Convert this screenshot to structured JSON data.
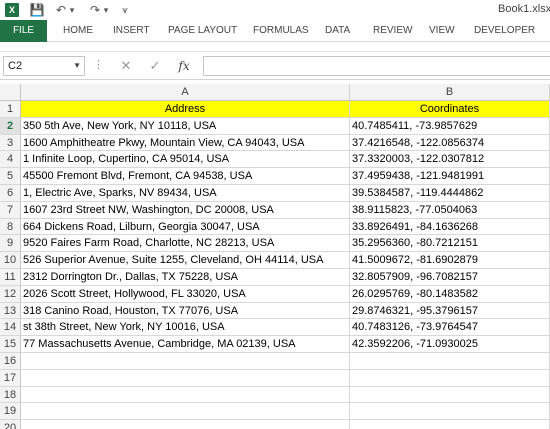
{
  "app": {
    "logo_letter": "X",
    "window_title": "Book1.xlsx -"
  },
  "quick_access": [
    {
      "name": "save-icon",
      "glyph": "💾"
    },
    {
      "name": "undo-icon",
      "glyph": "↶"
    },
    {
      "name": "undo-dropdown-icon",
      "glyph": "▾"
    },
    {
      "name": "redo-icon",
      "glyph": "↷"
    },
    {
      "name": "redo-dropdown-icon",
      "glyph": "▾"
    },
    {
      "name": "customize-toolbar-icon",
      "glyph": "⩛"
    }
  ],
  "ribbon": {
    "tabs": [
      "FILE",
      "HOME",
      "INSERT",
      "PAGE LAYOUT",
      "FORMULAS",
      "DATA",
      "REVIEW",
      "VIEW",
      "DEVELOPER"
    ]
  },
  "formula_bar": {
    "name_box": "C2",
    "separator": "⋮",
    "cancel_glyph": "✕",
    "enter_glyph": "✓",
    "fx_label": "fx",
    "formula": ""
  },
  "grid": {
    "columns": [
      "A",
      "B"
    ],
    "active_cell": "C2",
    "rows": [
      {
        "num": "1",
        "a": "Address",
        "b": "Coordinates"
      },
      {
        "num": "2",
        "a": "350 5th Ave, New York, NY 10118, USA",
        "b": "40.7485411, -73.9857629"
      },
      {
        "num": "3",
        "a": "1600 Amphitheatre Pkwy, Mountain View, CA 94043, USA",
        "b": "37.4216548, -122.0856374"
      },
      {
        "num": "4",
        "a": "1 Infinite Loop, Cupertino, CA 95014, USA",
        "b": "37.3320003, -122.0307812"
      },
      {
        "num": "5",
        "a": "45500 Fremont Blvd, Fremont, CA 94538, USA",
        "b": "37.4959438, -121.9481991"
      },
      {
        "num": "6",
        "a": "1, Electric Ave, Sparks, NV 89434, USA",
        "b": "39.5384587, -119.4444862"
      },
      {
        "num": "7",
        "a": "1607 23rd Street NW, Washington, DC 20008, USA",
        "b": "38.9115823, -77.0504063"
      },
      {
        "num": "8",
        "a": "664 Dickens Road, Lilburn, Georgia 30047, USA",
        "b": "33.8926491, -84.1636268"
      },
      {
        "num": "9",
        "a": "9520 Faires Farm Road, Charlotte, NC 28213, USA",
        "b": "35.2956360, -80.7212151"
      },
      {
        "num": "10",
        "a": "526 Superior Avenue, Suite 1255, Cleveland, OH 44114, USA",
        "b": "41.5009672, -81.6902879"
      },
      {
        "num": "11",
        "a": "2312 Dorrington Dr., Dallas, TX 75228, USA",
        "b": "32.8057909, -96.7082157"
      },
      {
        "num": "12",
        "a": "2026 Scott Street, Hollywood, FL 33020, USA",
        "b": "26.0295769, -80.1483582"
      },
      {
        "num": "13",
        "a": "318 Canino Road, Houston, TX 77076, USA",
        "b": "29.8746321, -95.3796157"
      },
      {
        "num": "14",
        "a": "st 38th Street, New York, NY 10016, USA",
        "b": "40.7483126, -73.9764547"
      },
      {
        "num": "15",
        "a": "77 Massachusetts Avenue, Cambridge, MA 02139, USA",
        "b": "42.3592206, -71.0930025"
      },
      {
        "num": "16",
        "a": "",
        "b": ""
      },
      {
        "num": "17",
        "a": "",
        "b": ""
      },
      {
        "num": "18",
        "a": "",
        "b": ""
      },
      {
        "num": "19",
        "a": "",
        "b": ""
      },
      {
        "num": "20",
        "a": "",
        "b": ""
      }
    ]
  },
  "colors": {
    "accent": "#217346",
    "header_fill": "#ffff00"
  }
}
